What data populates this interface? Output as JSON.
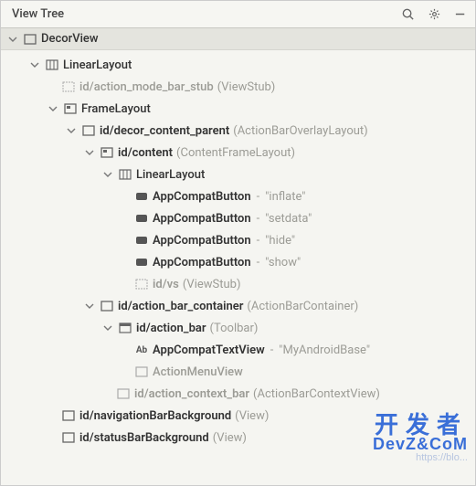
{
  "header": {
    "title": "View Tree"
  },
  "root": {
    "name": "DecorView"
  },
  "nodes": {
    "linearLayout1": "LinearLayout",
    "actionModeBarStub": {
      "id": "id/action_mode_bar_stub",
      "type": "(ViewStub)"
    },
    "frameLayout": "FrameLayout",
    "decorContentParent": {
      "id": "id/decor_content_parent",
      "type": "(ActionBarOverlayLayout)"
    },
    "content": {
      "id": "id/content",
      "type": "(ContentFrameLayout)"
    },
    "linearLayout2": "LinearLayout",
    "btn1": {
      "name": "AppCompatButton",
      "text": "inflate"
    },
    "btn2": {
      "name": "AppCompatButton",
      "text": "setdata"
    },
    "btn3": {
      "name": "AppCompatButton",
      "text": "hide"
    },
    "btn4": {
      "name": "AppCompatButton",
      "text": "show"
    },
    "vs": {
      "id": "id/vs",
      "type": "(ViewStub)"
    },
    "actionBarContainer": {
      "id": "id/action_bar_container",
      "type": "(ActionBarContainer)"
    },
    "actionBar": {
      "id": "id/action_bar",
      "type": "(Toolbar)"
    },
    "textView": {
      "name": "AppCompatTextView",
      "text": "MyAndroidBase"
    },
    "actionMenuView": "ActionMenuView",
    "actionContextBar": {
      "id": "id/action_context_bar",
      "type": "(ActionBarContextView)"
    },
    "navBar": {
      "id": "id/navigationBarBackground",
      "type": "(View)"
    },
    "statusBar": {
      "id": "id/statusBarBackground",
      "type": "(View)"
    }
  },
  "watermark": {
    "line1": "开发者",
    "line2": "DevZ&CoM",
    "line3": "https://blo..."
  }
}
